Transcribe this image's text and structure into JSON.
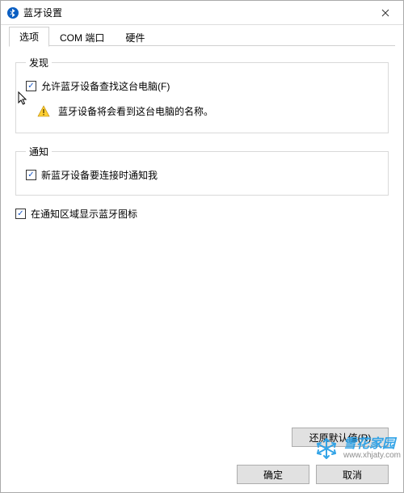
{
  "window": {
    "title": "蓝牙设置"
  },
  "tabs": {
    "options": "选项",
    "com": "COM 端口",
    "hardware": "硬件"
  },
  "discover": {
    "legend": "发现",
    "allow_label": "允许蓝牙设备查找这台电脑(F)",
    "info_text": "蓝牙设备将会看到这台电脑的名称。"
  },
  "notify": {
    "legend": "通知",
    "notify_label": "新蓝牙设备要连接时通知我"
  },
  "tray": {
    "label": "在通知区域显示蓝牙图标"
  },
  "buttons": {
    "restore": "还原默认值(R)",
    "ok": "确定",
    "cancel": "取消"
  },
  "watermark": {
    "name": "雪花家园",
    "url": "www.xhjaty.com"
  }
}
